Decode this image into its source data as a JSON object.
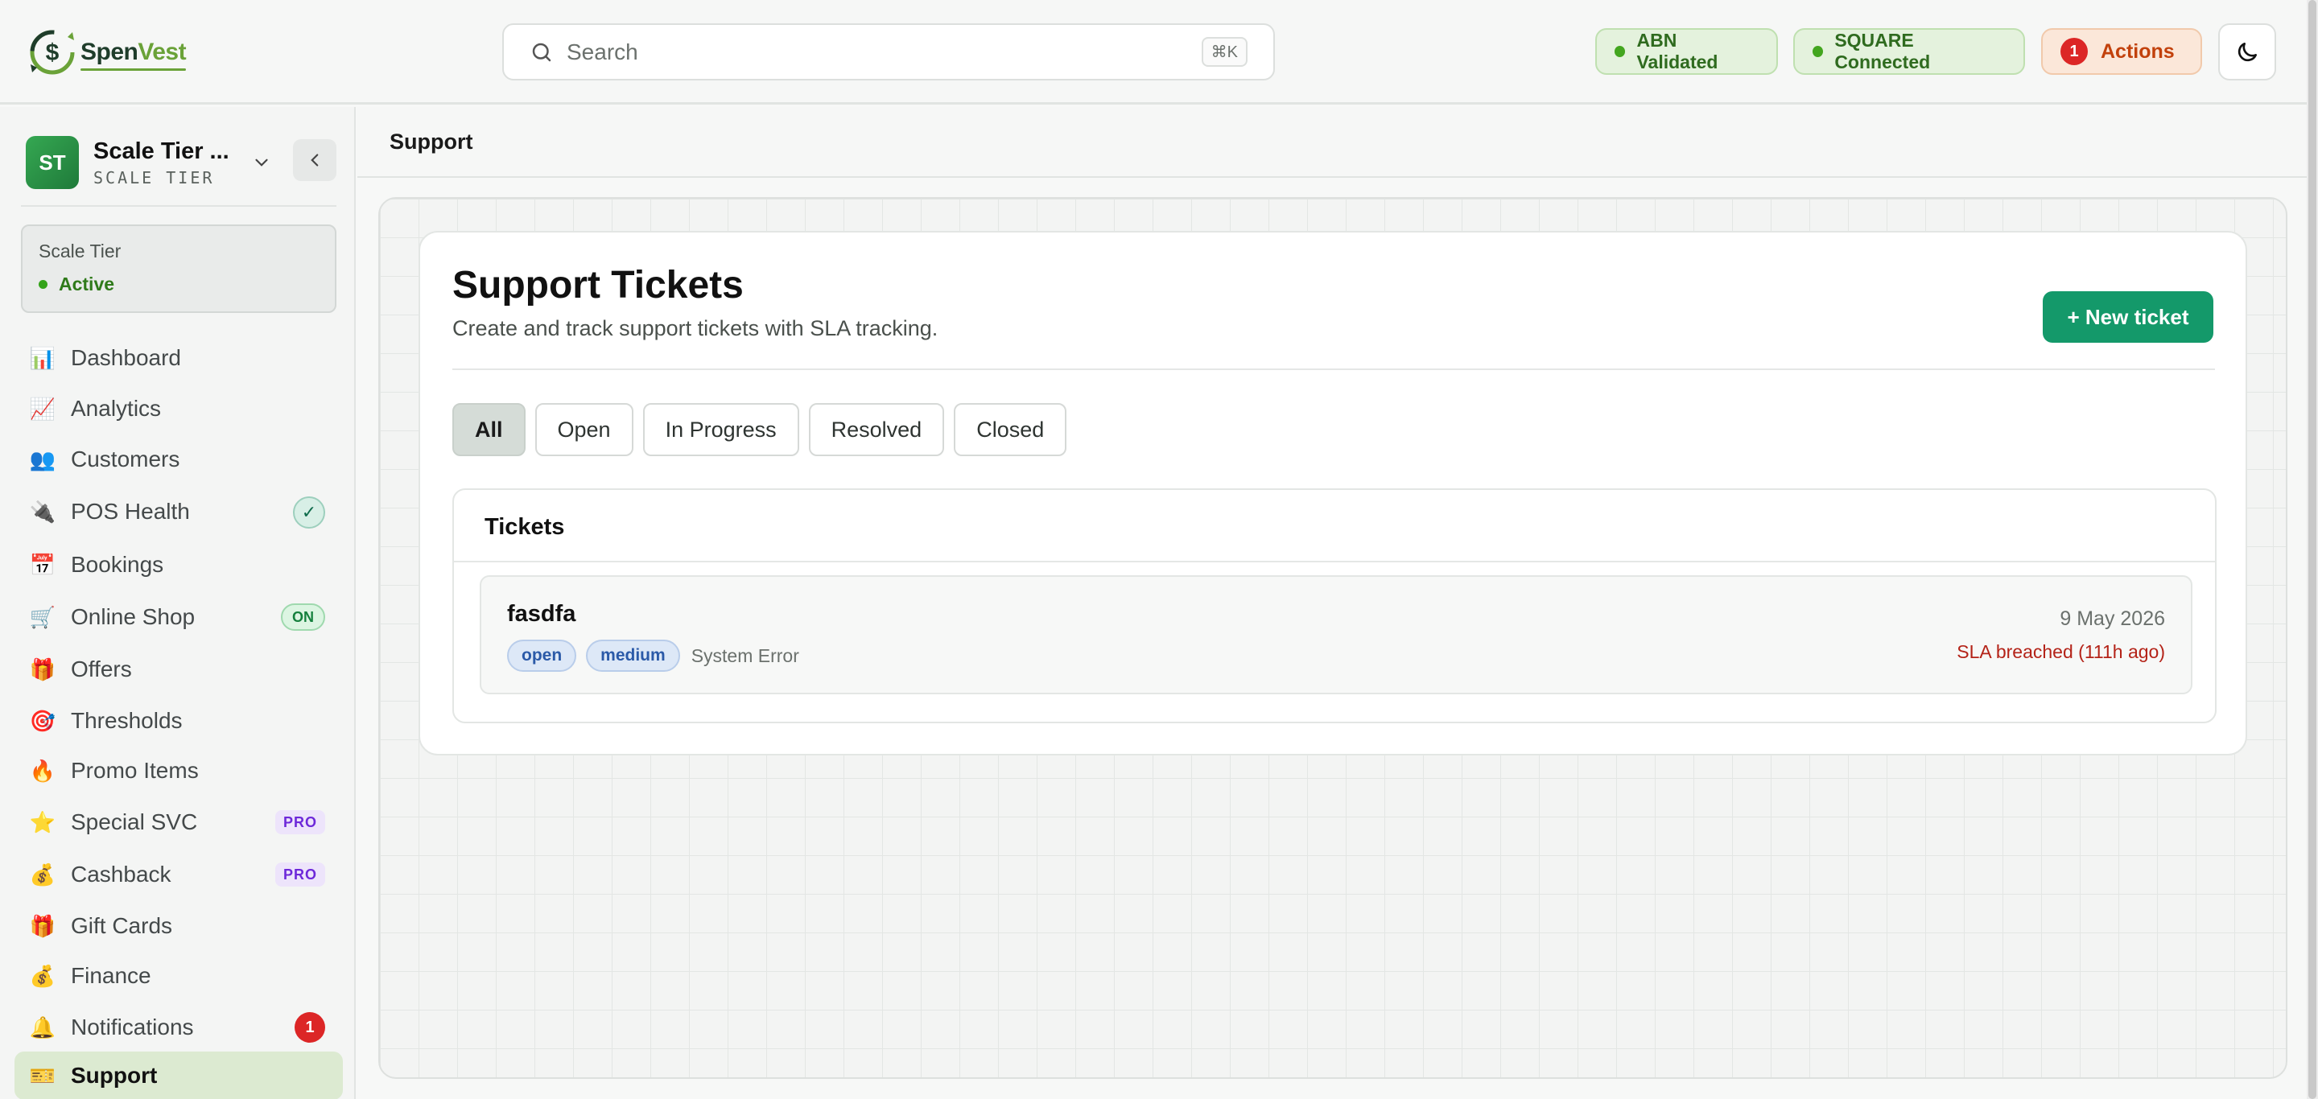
{
  "brand": {
    "name_part1": "Spen",
    "name_part2": "Vest",
    "colors": {
      "primary": "#14996a",
      "accent": "#6aa238",
      "danger": "#dc2626"
    }
  },
  "header": {
    "search_placeholder": "Search",
    "search_shortcut": "⌘K",
    "status_pills": [
      {
        "label": "ABN Validated",
        "state": "ok"
      },
      {
        "label": "SQUARE Connected",
        "state": "ok"
      }
    ],
    "actions": {
      "count": "1",
      "label": "Actions"
    },
    "theme_icon": "moon-icon"
  },
  "sidebar": {
    "workspace": {
      "initials": "ST",
      "name": "Scale Tier ...",
      "tier": "SCALE TIER"
    },
    "tier_card": {
      "label": "Scale Tier",
      "status": "Active"
    },
    "items": [
      {
        "icon": "📊",
        "icon_name": "bar-chart-icon",
        "label": "Dashboard"
      },
      {
        "icon": "📈",
        "icon_name": "trending-chart-icon",
        "label": "Analytics"
      },
      {
        "icon": "👥",
        "icon_name": "users-icon",
        "label": "Customers"
      },
      {
        "icon": "🔌",
        "icon_name": "plug-icon",
        "label": "POS Health",
        "badge": "✓"
      },
      {
        "icon": "📅",
        "icon_name": "calendar-icon",
        "label": "Bookings"
      },
      {
        "icon": "🛒",
        "icon_name": "cart-icon",
        "label": "Online Shop",
        "badge": "ON"
      },
      {
        "icon": "🎁",
        "icon_name": "gift-icon",
        "label": "Offers"
      },
      {
        "icon": "🎯",
        "icon_name": "target-icon",
        "label": "Thresholds"
      },
      {
        "icon": "🔥",
        "icon_name": "fire-icon",
        "label": "Promo Items"
      },
      {
        "icon": "⭐",
        "icon_name": "star-icon",
        "label": "Special SVC",
        "badge": "PRO"
      },
      {
        "icon": "💰",
        "icon_name": "money-bag-icon",
        "label": "Cashback",
        "badge": "PRO"
      },
      {
        "icon": "🎁",
        "icon_name": "gift-icon",
        "label": "Gift Cards"
      },
      {
        "icon": "💰",
        "icon_name": "money-bag-icon",
        "label": "Finance"
      },
      {
        "icon": "🔔",
        "icon_name": "bell-icon",
        "label": "Notifications",
        "badge": "1"
      },
      {
        "icon": "🎫",
        "icon_name": "ticket-icon",
        "label": "Support",
        "active": true
      }
    ]
  },
  "breadcrumb": "Support",
  "page": {
    "title": "Support Tickets",
    "subtitle": "Create and track support tickets with SLA tracking.",
    "new_button": "+ New ticket",
    "filters": [
      "All",
      "Open",
      "In Progress",
      "Resolved",
      "Closed"
    ],
    "active_filter": "All",
    "tickets_heading": "Tickets",
    "tickets": [
      {
        "title": "fasdfa",
        "status": "open",
        "priority": "medium",
        "category": "System Error",
        "date": "9 May 2026",
        "sla": "SLA breached (111h ago)"
      }
    ]
  }
}
